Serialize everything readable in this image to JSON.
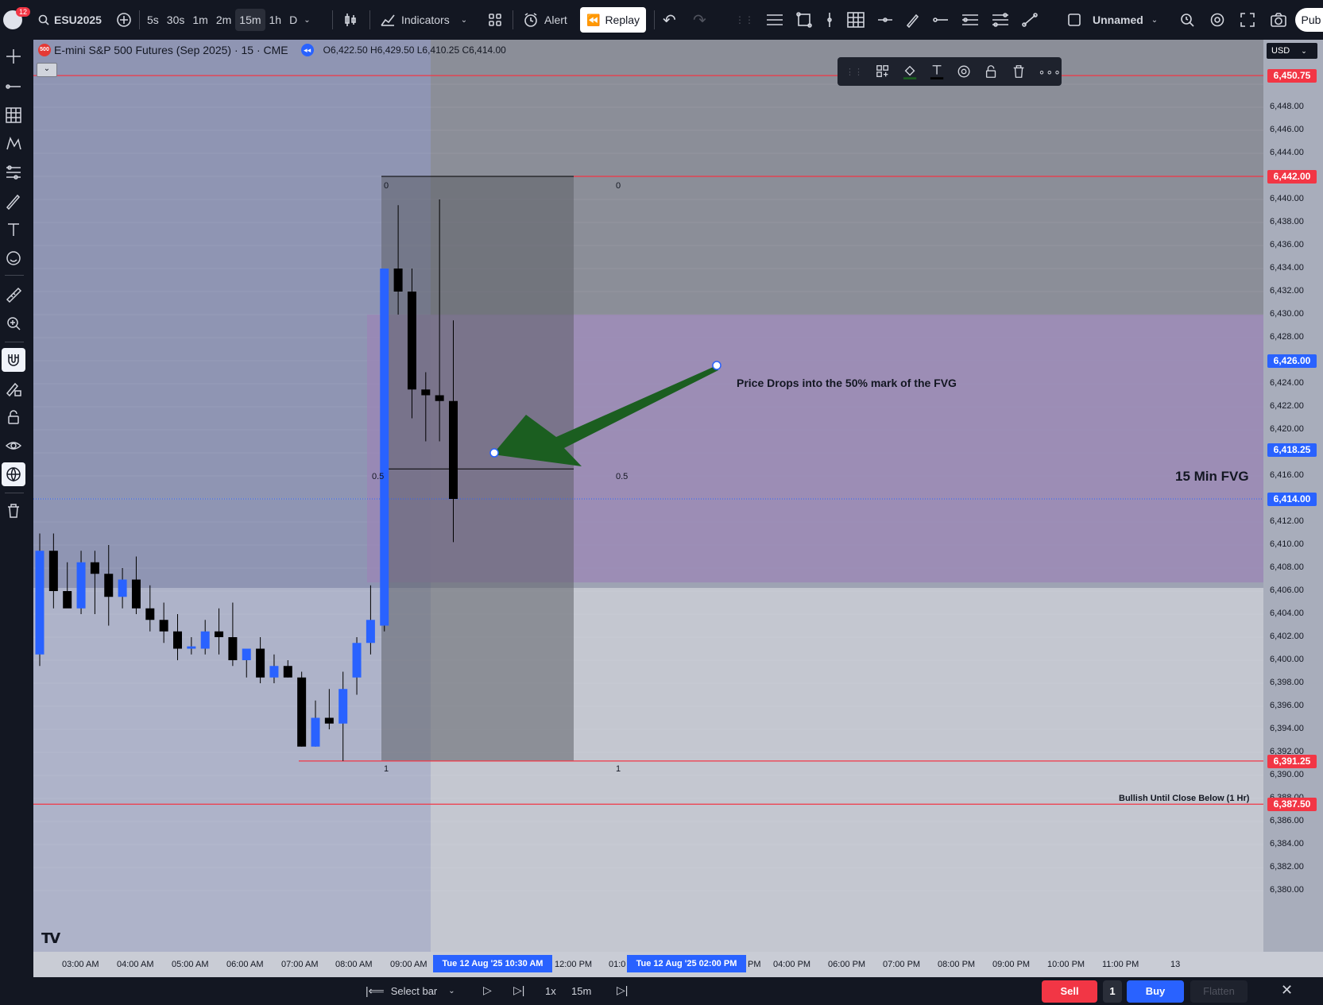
{
  "topbar": {
    "notif_count": "12",
    "symbol": "ESU2025",
    "intervals": [
      "5s",
      "30s",
      "1m",
      "2m",
      "15m",
      "1h",
      "D"
    ],
    "active_interval": "15m",
    "indicators_label": "Indicators",
    "alert_label": "Alert",
    "replay_label": "Replay",
    "layout_name": "Unnamed",
    "publish_label": "Pub"
  },
  "legend": {
    "badge": "500",
    "title": "E-mini S&P 500 Futures (Sep 2025) · 15 · CME",
    "ohlc": "O6,422.50  H6,429.50  L6,410.25  C6,414.00",
    "currency": "USD"
  },
  "price_axis": {
    "ticks": [
      "6,448.00",
      "6,446.00",
      "6,444.00",
      "6,440.00",
      "6,438.00",
      "6,436.00",
      "6,434.00",
      "6,432.00",
      "6,430.00",
      "6,428.00",
      "6,424.00",
      "6,422.00",
      "6,420.00",
      "6,416.00",
      "6,412.00",
      "6,410.00",
      "6,408.00",
      "6,406.00",
      "6,404.00",
      "6,402.00",
      "6,400.00",
      "6,398.00",
      "6,396.00",
      "6,394.00",
      "6,392.00",
      "6,390.00",
      "6,388.00",
      "6,386.00",
      "6,384.00",
      "6,382.00",
      "6,380.00"
    ],
    "tags": [
      {
        "text": "6,450.75",
        "color": "#f23645"
      },
      {
        "text": "6,442.00",
        "color": "#f23645"
      },
      {
        "text": "6,426.00",
        "color": "#2962ff"
      },
      {
        "text": "6,418.25",
        "color": "#2962ff"
      },
      {
        "text": "6,414.00",
        "color": "#2962ff"
      },
      {
        "text": "6,391.25",
        "color": "#f23645"
      },
      {
        "text": "6,387.50",
        "color": "#f23645"
      }
    ]
  },
  "time_axis": {
    "labels": [
      "03:00 AM",
      "04:00 AM",
      "05:00 AM",
      "06:00 AM",
      "07:00 AM",
      "08:00 AM",
      "09:00 AM",
      "12:00 PM",
      "01:0",
      "PM",
      "04:00 PM",
      "06:00 PM",
      "07:00 PM",
      "08:00 PM",
      "09:00 PM",
      "10:00 PM",
      "11:00 PM",
      "13"
    ],
    "highlight_1": "Tue 12 Aug '25   10:30 AM",
    "highlight_2": "Tue 12 Aug '25   02:00 PM"
  },
  "annotations": {
    "fib_0": "0",
    "fib_half": "0.5",
    "fib_1": "1",
    "arrow_text": "Price Drops into the 50% mark of the FVG",
    "fvg_label": "15 Min FVG",
    "bullish_label": "Bullish Until Close Below (1 Hr)"
  },
  "bottombar": {
    "select_bar": "Select bar",
    "speed": "1x",
    "interval": "15m",
    "sell": "Sell",
    "qty": "1",
    "buy": "Buy",
    "flatten": "Flatten"
  },
  "colors": {
    "bull": "#2962ff",
    "bear": "#000000",
    "level_line": "#f23645",
    "fvg_zone": "#9b86b5",
    "arrow": "#1b5e20"
  },
  "candles": [
    {
      "o": 6400.5,
      "h": 6411,
      "l": 6399.5,
      "c": 6409.5
    },
    {
      "o": 6409.5,
      "h": 6411,
      "l": 6404.5,
      "c": 6406.0
    },
    {
      "o": 6406.0,
      "h": 6408.5,
      "l": 6405.0,
      "c": 6404.5
    },
    {
      "o": 6404.5,
      "h": 6409.5,
      "l": 6404.0,
      "c": 6408.5
    },
    {
      "o": 6408.5,
      "h": 6409.5,
      "l": 6404.0,
      "c": 6407.5
    },
    {
      "o": 6407.5,
      "h": 6410.0,
      "l": 6403.0,
      "c": 6405.5
    },
    {
      "o": 6405.5,
      "h": 6408.0,
      "l": 6404.5,
      "c": 6407.0
    },
    {
      "o": 6407.0,
      "h": 6409.0,
      "l": 6404.0,
      "c": 6404.5
    },
    {
      "o": 6404.5,
      "h": 6406.5,
      "l": 6402.5,
      "c": 6403.5
    },
    {
      "o": 6403.5,
      "h": 6405.0,
      "l": 6401.5,
      "c": 6402.5
    },
    {
      "o": 6402.5,
      "h": 6404.0,
      "l": 6400.0,
      "c": 6401.0
    },
    {
      "o": 6401.0,
      "h": 6402.0,
      "l": 6400.5,
      "c": 6401.2
    },
    {
      "o": 6401.0,
      "h": 6403.5,
      "l": 6400.5,
      "c": 6402.5
    },
    {
      "o": 6402.5,
      "h": 6404.5,
      "l": 6400.5,
      "c": 6402.0
    },
    {
      "o": 6402.0,
      "h": 6405.0,
      "l": 6399.5,
      "c": 6400.0
    },
    {
      "o": 6400.0,
      "h": 6401.0,
      "l": 6398.5,
      "c": 6401.0
    },
    {
      "o": 6401.0,
      "h": 6402.0,
      "l": 6398.0,
      "c": 6398.5
    },
    {
      "o": 6398.5,
      "h": 6400.5,
      "l": 6398.0,
      "c": 6399.5
    },
    {
      "o": 6399.5,
      "h": 6400.0,
      "l": 6398.5,
      "c": 6398.5
    },
    {
      "o": 6398.5,
      "h": 6399.0,
      "l": 6392.5,
      "c": 6392.5
    },
    {
      "o": 6392.5,
      "h": 6396.5,
      "l": 6392.5,
      "c": 6395.0
    },
    {
      "o": 6395.0,
      "h": 6397.5,
      "l": 6394.0,
      "c": 6394.5
    },
    {
      "o": 6394.5,
      "h": 6399.0,
      "l": 6391.25,
      "c": 6397.5
    },
    {
      "o": 6398.5,
      "h": 6402.0,
      "l": 6397.0,
      "c": 6401.5
    },
    {
      "o": 6401.5,
      "h": 6406.5,
      "l": 6400.5,
      "c": 6403.5
    },
    {
      "o": 6403.0,
      "h": 6434.0,
      "l": 6402.5,
      "c": 6434.0
    },
    {
      "o": 6434.0,
      "h": 6439.5,
      "l": 6430.0,
      "c": 6432.0
    },
    {
      "o": 6432.0,
      "h": 6434.0,
      "l": 6421.0,
      "c": 6423.5
    },
    {
      "o": 6423.5,
      "h": 6425.0,
      "l": 6419.0,
      "c": 6423.0
    },
    {
      "o": 6423.0,
      "h": 6440.0,
      "l": 6419.0,
      "c": 6422.5
    },
    {
      "o": 6422.5,
      "h": 6429.5,
      "l": 6410.25,
      "c": 6414.0
    }
  ]
}
